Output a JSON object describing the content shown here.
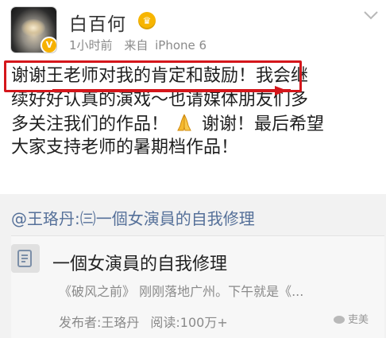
{
  "header": {
    "username": "白百何",
    "vip_badge": "crown-badge-icon",
    "time": "1小时前",
    "source_label": "来自",
    "device": "iPhone 6",
    "menu_icon": "chevron-down-icon"
  },
  "post": {
    "line1_highlight": "谢谢王老师对我的肯定和鼓励！",
    "line1_rest": "我会继",
    "line2": "续好好认真的演戏～也请媒体朋友们多",
    "line3_a": "多关注我们的作品！",
    "line3_b": "谢谢！最后希望",
    "line4": "大家支持老师的暑期档作品！",
    "emoji": "pray-icon",
    "annotation_color": "#d4161b"
  },
  "repost": {
    "header": "@王珞丹:㈢一個女演員的自我修理",
    "card": {
      "title": "一個女演員的自我修理",
      "desc": "《破风之前》  刚刚落地广州。下午就是《...",
      "publisher": "发布者:王珞丹",
      "reads_label": "阅读:100万+"
    }
  },
  "watermark": {
    "text": "吏美"
  },
  "colors": {
    "link": "#557099",
    "text": "#1f1f1f",
    "meta": "#8a8a8a",
    "repost_bg": "#f2f2f2"
  }
}
